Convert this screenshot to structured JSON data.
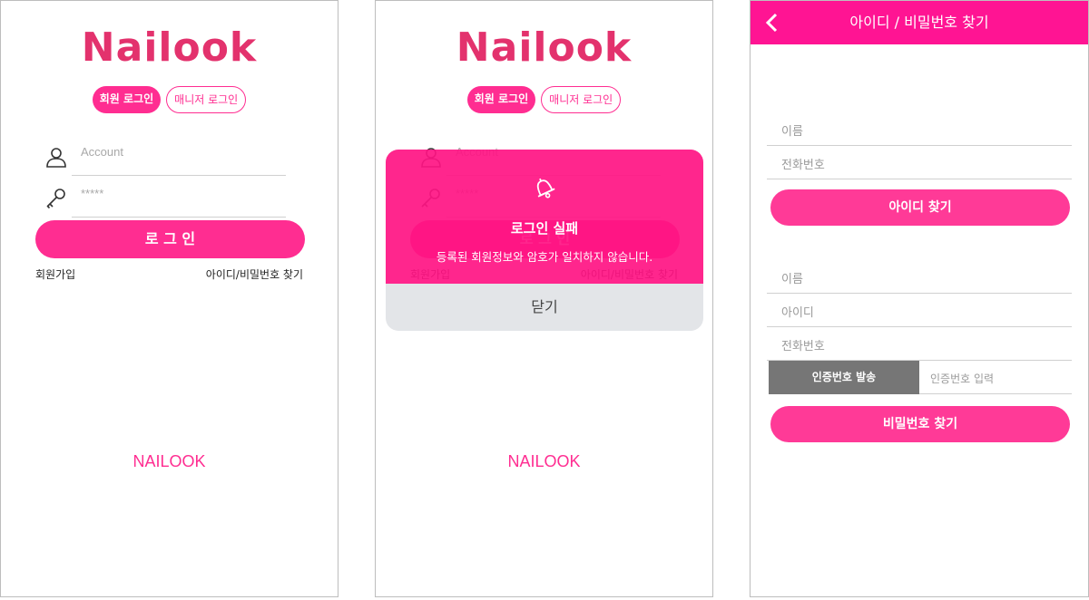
{
  "colors": {
    "accent": "#ff2d91",
    "logo": "#e3326d",
    "header": "#ff1493",
    "dialog": "#ff1483"
  },
  "login": {
    "logo": "Nailook",
    "tab_member": "회원 로그인",
    "tab_manager": "매니저 로그인",
    "account_placeholder": "Account",
    "password_placeholder": "*****",
    "login_button": "로 그 인",
    "signup_link": "회원가입",
    "find_link": "아이디/비밀번호 찾기",
    "footer": "NAILOOK",
    "icons": {
      "account": "user-icon",
      "password": "key-icon"
    }
  },
  "alert": {
    "title": "로그인 실패",
    "message": "등록된 회원정보와 암호가 일치하지 않습니다.",
    "close": "닫기",
    "icon": "bell-icon"
  },
  "find": {
    "header_title": "아이디 / 비밀번호 찾기",
    "back_icon": "chevron-left-icon",
    "id_section": {
      "name_placeholder": "이름",
      "phone_placeholder": "전화번호",
      "button": "아이디 찾기"
    },
    "pw_section": {
      "name_placeholder": "이름",
      "id_placeholder": "아이디",
      "phone_placeholder": "전화번호",
      "send_code": "인증번호 발송",
      "code_placeholder": "인증번호 입력",
      "button": "비밀번호 찾기"
    }
  }
}
